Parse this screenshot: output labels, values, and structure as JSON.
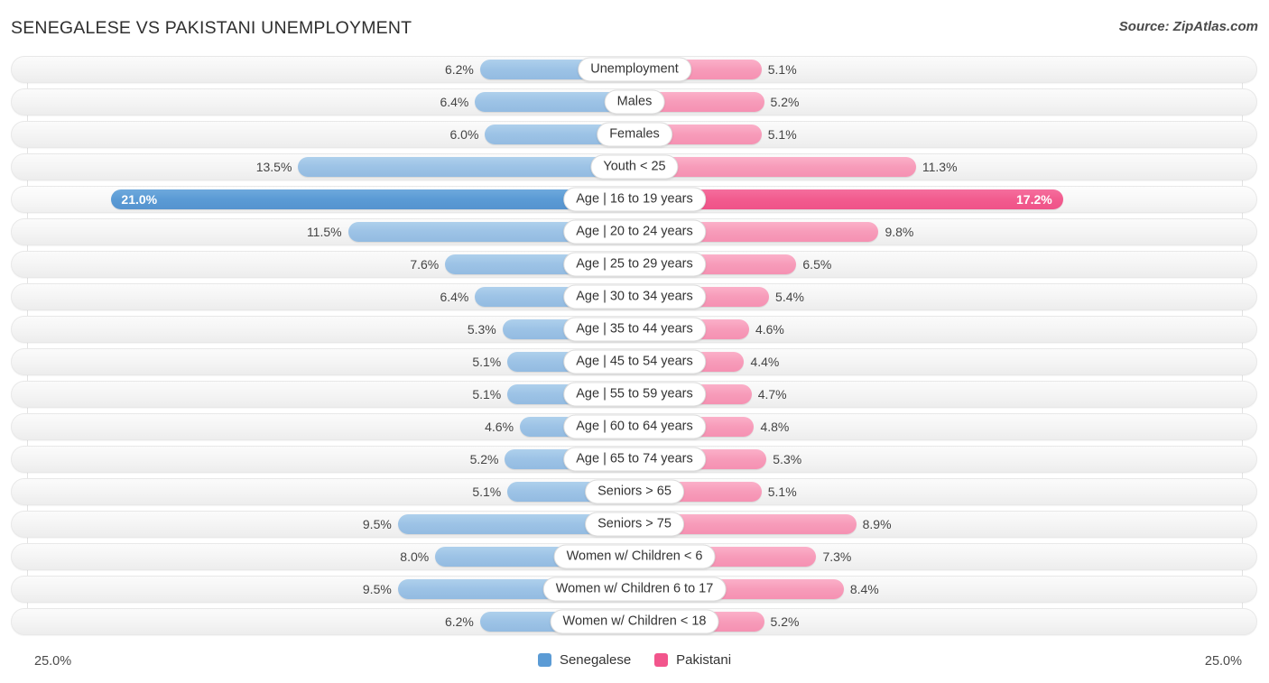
{
  "header": {
    "title": "SENEGALESE VS PAKISTANI UNEMPLOYMENT",
    "source": "Source: ZipAtlas.com"
  },
  "legend": {
    "items": [
      {
        "label": "Senegalese",
        "color": "#5b9bd5"
      },
      {
        "label": "Pakistani",
        "color": "#f2558c"
      }
    ]
  },
  "axis": {
    "min_label": "25.0%",
    "max_label": "25.0%"
  },
  "chart_data": {
    "type": "bar",
    "orientation": "horizontal",
    "style": "diverging-bidirectional",
    "title": "SENEGALESE VS PAKISTANI UNEMPLOYMENT",
    "xlabel": "",
    "ylabel": "",
    "xlim": [
      25.0,
      25.0
    ],
    "axis_max_percent": 25.0,
    "grid": true,
    "legend_position": "bottom-center",
    "categories": [
      "Unemployment",
      "Males",
      "Females",
      "Youth < 25",
      "Age | 16 to 19 years",
      "Age | 20 to 24 years",
      "Age | 25 to 29 years",
      "Age | 30 to 34 years",
      "Age | 35 to 44 years",
      "Age | 45 to 54 years",
      "Age | 55 to 59 years",
      "Age | 60 to 64 years",
      "Age | 65 to 74 years",
      "Seniors > 65",
      "Seniors > 75",
      "Women w/ Children < 6",
      "Women w/ Children 6 to 17",
      "Women w/ Children < 18"
    ],
    "series": [
      {
        "name": "Senegalese",
        "color": "#9dc3e6",
        "highlight_color": "#5b9bd5",
        "values": [
          6.2,
          6.4,
          6.0,
          13.5,
          21.0,
          11.5,
          7.6,
          6.4,
          5.3,
          5.1,
          5.1,
          4.6,
          5.2,
          5.1,
          9.5,
          8.0,
          9.5,
          6.2
        ]
      },
      {
        "name": "Pakistani",
        "color": "#f79cba",
        "highlight_color": "#f2558c",
        "values": [
          5.1,
          5.2,
          5.1,
          11.3,
          17.2,
          9.8,
          6.5,
          5.4,
          4.6,
          4.4,
          4.7,
          4.8,
          5.3,
          5.1,
          8.9,
          7.3,
          8.4,
          5.2
        ]
      }
    ]
  },
  "rows": [
    {
      "label": "Unemployment",
      "left_value": "6.2%",
      "right_value": "5.1%",
      "left_pct": 6.2,
      "right_pct": 5.1,
      "highlight": false
    },
    {
      "label": "Males",
      "left_value": "6.4%",
      "right_value": "5.2%",
      "left_pct": 6.4,
      "right_pct": 5.2,
      "highlight": false
    },
    {
      "label": "Females",
      "left_value": "6.0%",
      "right_value": "5.1%",
      "left_pct": 6.0,
      "right_pct": 5.1,
      "highlight": false
    },
    {
      "label": "Youth < 25",
      "left_value": "13.5%",
      "right_value": "11.3%",
      "left_pct": 13.5,
      "right_pct": 11.3,
      "highlight": false
    },
    {
      "label": "Age | 16 to 19 years",
      "left_value": "21.0%",
      "right_value": "17.2%",
      "left_pct": 21.0,
      "right_pct": 17.2,
      "highlight": true
    },
    {
      "label": "Age | 20 to 24 years",
      "left_value": "11.5%",
      "right_value": "9.8%",
      "left_pct": 11.5,
      "right_pct": 9.8,
      "highlight": false
    },
    {
      "label": "Age | 25 to 29 years",
      "left_value": "7.6%",
      "right_value": "6.5%",
      "left_pct": 7.6,
      "right_pct": 6.5,
      "highlight": false
    },
    {
      "label": "Age | 30 to 34 years",
      "left_value": "6.4%",
      "right_value": "5.4%",
      "left_pct": 6.4,
      "right_pct": 5.4,
      "highlight": false
    },
    {
      "label": "Age | 35 to 44 years",
      "left_value": "5.3%",
      "right_value": "4.6%",
      "left_pct": 5.3,
      "right_pct": 4.6,
      "highlight": false
    },
    {
      "label": "Age | 45 to 54 years",
      "left_value": "5.1%",
      "right_value": "4.4%",
      "left_pct": 5.1,
      "right_pct": 4.4,
      "highlight": false
    },
    {
      "label": "Age | 55 to 59 years",
      "left_value": "5.1%",
      "right_value": "4.7%",
      "left_pct": 5.1,
      "right_pct": 4.7,
      "highlight": false
    },
    {
      "label": "Age | 60 to 64 years",
      "left_value": "4.6%",
      "right_value": "4.8%",
      "left_pct": 4.6,
      "right_pct": 4.8,
      "highlight": false
    },
    {
      "label": "Age | 65 to 74 years",
      "left_value": "5.2%",
      "right_value": "5.3%",
      "left_pct": 5.2,
      "right_pct": 5.3,
      "highlight": false
    },
    {
      "label": "Seniors > 65",
      "left_value": "5.1%",
      "right_value": "5.1%",
      "left_pct": 5.1,
      "right_pct": 5.1,
      "highlight": false
    },
    {
      "label": "Seniors > 75",
      "left_value": "9.5%",
      "right_value": "8.9%",
      "left_pct": 9.5,
      "right_pct": 8.9,
      "highlight": false
    },
    {
      "label": "Women w/ Children < 6",
      "left_value": "8.0%",
      "right_value": "7.3%",
      "left_pct": 8.0,
      "right_pct": 7.3,
      "highlight": false
    },
    {
      "label": "Women w/ Children 6 to 17",
      "left_value": "9.5%",
      "right_value": "8.4%",
      "left_pct": 9.5,
      "right_pct": 8.4,
      "highlight": false
    },
    {
      "label": "Women w/ Children < 18",
      "left_value": "6.2%",
      "right_value": "5.2%",
      "left_pct": 6.2,
      "right_pct": 5.2,
      "highlight": false
    }
  ]
}
